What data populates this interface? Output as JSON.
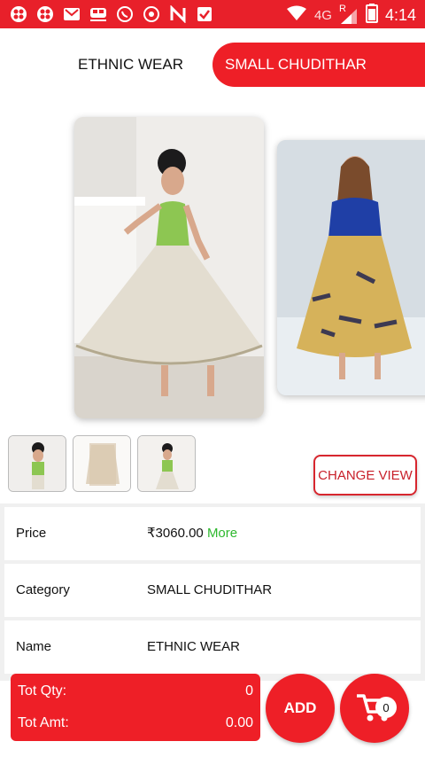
{
  "status_bar": {
    "icons": [
      "app-icon",
      "app-icon",
      "gmail-icon",
      "train-icon",
      "whatsapp-icon",
      "chat-icon",
      "n-icon",
      "check-icon"
    ],
    "network": "4G",
    "roaming": "R",
    "time": "4:14"
  },
  "tabs": [
    {
      "label": "ETHNIC WEAR"
    },
    {
      "label": "SMALL CHUDITHAR"
    }
  ],
  "change_view_label": "CHANGE VIEW",
  "details": {
    "price_label": "Price",
    "price_value": "₹3060.00",
    "more_label": "More",
    "category_label": "Category",
    "category_value": "SMALL CHUDITHAR",
    "name_label": "Name",
    "name_value": "ETHNIC WEAR"
  },
  "totals": {
    "qty_label": "Tot Qty:",
    "qty_value": "0",
    "amt_label": "Tot Amt:",
    "amt_value": "0.00"
  },
  "add_label": "ADD",
  "cart_count": "0",
  "colors": {
    "brand_red": "#ee1f27",
    "more_green": "#2eb82e"
  }
}
